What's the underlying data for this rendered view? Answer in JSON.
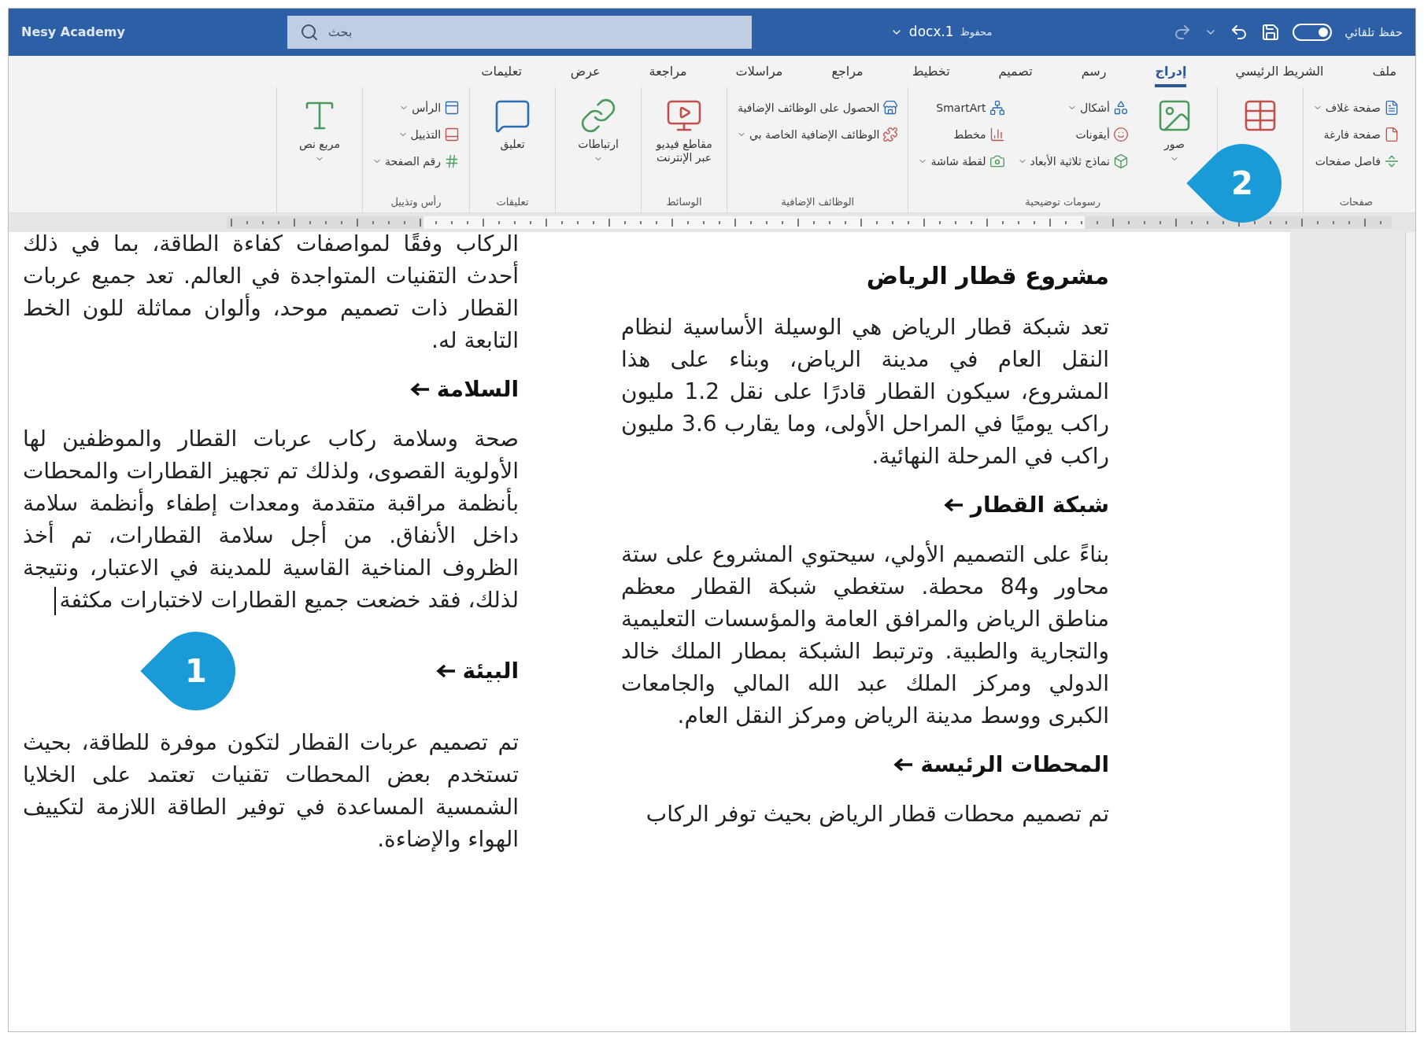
{
  "title_bar": {
    "account": "Nesy Academy",
    "search": {
      "placeholder": "بحث"
    },
    "document": "docx.1",
    "save_status": "محفوظ",
    "autosave": {
      "label": "حفظ تلقائي",
      "on": true
    }
  },
  "tabs": [
    {
      "label": "ملف",
      "selected": false
    },
    {
      "label": "الشريط الرئيسي",
      "selected": false
    },
    {
      "label": "إدراج",
      "selected": true
    },
    {
      "label": "رسم",
      "selected": false
    },
    {
      "label": "تصميم",
      "selected": false
    },
    {
      "label": "تخطيط",
      "selected": false
    },
    {
      "label": "مراجع",
      "selected": false
    },
    {
      "label": "مراسلات",
      "selected": false
    },
    {
      "label": "مراجعة",
      "selected": false
    },
    {
      "label": "عرض",
      "selected": false
    },
    {
      "label": "تعليمات",
      "selected": false
    }
  ],
  "ribbon_groups": [
    {
      "label": "صفحات",
      "columns": [
        {
          "kind": "stack",
          "items": [
            {
              "label": "صفحة غلاف",
              "dropdown": true
            },
            {
              "label": "صفحة فارغة",
              "dropdown": false
            },
            {
              "label": "فاصل صفحات",
              "dropdown": false
            }
          ]
        }
      ]
    },
    {
      "columns": [
        {
          "kind": "large",
          "dropdown": false
        }
      ]
    },
    {
      "label": "رسومات توضيحية",
      "columns": [
        {
          "kind": "large",
          "label": "صور",
          "dropdown": true
        },
        {
          "kind": "stack",
          "items": [
            {
              "label": "أشكال",
              "dropdown": true
            },
            {
              "label": "أيقونات",
              "dropdown": false
            },
            {
              "label": "نماذج ثلاثية الأبعاد",
              "dropdown": true
            }
          ]
        },
        {
          "kind": "stack",
          "items": [
            {
              "label": "SmartArt",
              "dropdown": false
            },
            {
              "label": "مخطط",
              "dropdown": false
            },
            {
              "label": "لقطة شاشة",
              "dropdown": true
            }
          ]
        }
      ]
    },
    {
      "label": "الوظائف الإضافية",
      "columns": [
        {
          "kind": "stack",
          "items": [
            {
              "label": "الحصول على الوظائف الإضافية",
              "dropdown": false
            },
            {
              "label": "الوظائف الإضافية الخاصة بي",
              "dropdown": true
            }
          ]
        }
      ]
    },
    {
      "label": "الوسائط",
      "columns": [
        {
          "kind": "large",
          "label": "مقاطع فيديو عبر الإنترنت",
          "dropdown": false
        }
      ]
    },
    {
      "columns": [
        {
          "kind": "large",
          "label": "ارتباطات",
          "dropdown": true
        }
      ]
    },
    {
      "label": "تعليقات",
      "columns": [
        {
          "kind": "large",
          "label": "تعليق",
          "dropdown": false
        }
      ]
    },
    {
      "label": "رأس وتذييل",
      "columns": [
        {
          "kind": "stack",
          "items": [
            {
              "label": "الرأس",
              "dropdown": true
            },
            {
              "label": "التذييل",
              "dropdown": true
            },
            {
              "label": "رقم الصفحة",
              "dropdown": true
            }
          ]
        }
      ]
    },
    {
      "columns": [
        {
          "kind": "large",
          "label": "مربع نص",
          "dropdown": true
        }
      ]
    }
  ],
  "document": {
    "columns": [
      [
        {
          "kind": "title",
          "text": "مشروع قطار الرياض"
        },
        {
          "kind": "paragraph",
          "text": "تعد شبكة قطار الرياض هي الوسيلة الأساسية لنظام النقل العام في مدينة الرياض، وبناء على هذا المشروع، سيكون القطار قادرًا على نقل 1.2 مليون راكب يوميًا في المراحل الأولى، وما يقارب 3.6 مليون راكب في المرحلة النهائية."
        },
        {
          "kind": "heading",
          "text": "شبكة القطار"
        },
        {
          "kind": "paragraph",
          "text": "بناءً على التصميم الأولي، سيحتوي المشروع على ستة محاور و84 محطة. ستغطي شبكة القطار معظم مناطق الرياض والمرافق العامة والمؤسسات التعليمية والتجارية والطبية. وترتبط الشبكة بمطار الملك خالد الدولي ومركز الملك عبد الله المالي والجامعات الكبرى ووسط مدينة الرياض ومركز النقل العام."
        },
        {
          "kind": "heading",
          "text": "المحطات الرئيسة"
        },
        {
          "kind": "paragraph",
          "text": "تم تصميم محطات قطار الرياض بحيث توفر الركاب"
        }
      ],
      [
        {
          "kind": "paragraph",
          "text": "الركاب وفقًا لمواصفات كفاءة الطاقة، بما في ذلك أحدث التقنيات المتواجدة في العالم. تعد جميع عربات القطار ذات تصميم موحد، وألوان مماثلة للون الخط التابعة له."
        },
        {
          "kind": "heading",
          "text": "السلامة"
        },
        {
          "kind": "paragraph",
          "text": "صحة وسلامة ركاب عربات القطار والموظفين لها الأولوية القصوى، ولذلك تم تجهيز القطارات والمحطات بأنظمة مراقبة متقدمة ومعدات إطفاء وأنظمة سلامة داخل الأنفاق. من أجل سلامة القطارات، تم أخذ الظروف المناخية القاسية للمدينة في الاعتبار، ونتيجة لذلك، فقد خضعت جميع القطارات لاختبارات مكثفة",
          "cursor": true
        },
        {
          "kind": "heading",
          "text": "البيئة"
        },
        {
          "kind": "paragraph",
          "text": "تم تصميم عربات القطار لتكون موفرة للطاقة، بحيث تستخدم بعض المحطات تقنيات تعتمد على الخلايا الشمسية المساعدة في توفير الطاقة اللازمة لتكييف الهواء والإضاءة."
        }
      ]
    ]
  },
  "callouts": [
    {
      "label": "1"
    },
    {
      "label": "2"
    }
  ]
}
